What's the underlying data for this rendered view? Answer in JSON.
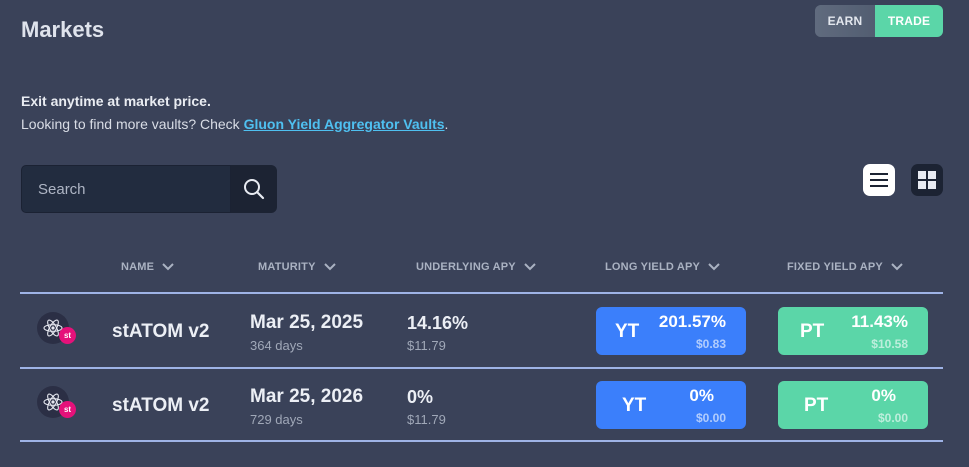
{
  "page": {
    "title": "Markets"
  },
  "mode_toggle": {
    "earn": "EARN",
    "trade": "TRADE",
    "active": "TRADE"
  },
  "intro": {
    "headline": "Exit anytime at market price.",
    "prefix": "Looking to find more vaults? Check ",
    "link": "Gluon Yield Aggregator Vaults",
    "suffix": "."
  },
  "search": {
    "placeholder": "Search",
    "value": ""
  },
  "view": {
    "active": "list"
  },
  "columns": {
    "name": "NAME",
    "maturity": "MATURITY",
    "underlying_apy": "UNDERLYING APY",
    "long_yield_apy": "LONG YIELD APY",
    "fixed_yield_apy": "FIXED YIELD APY"
  },
  "rows": [
    {
      "name": "stATOM v2",
      "badge": "st",
      "maturity_date": "Mar 25, 2025",
      "maturity_days": "364 days",
      "underlying_apy": "14.16%",
      "underlying_usd": "$11.79",
      "yt": {
        "label": "YT",
        "apy": "201.57%",
        "price": "$0.83"
      },
      "pt": {
        "label": "PT",
        "apy": "11.43%",
        "price": "$10.58"
      }
    },
    {
      "name": "stATOM v2",
      "badge": "st",
      "maturity_date": "Mar 25, 2026",
      "maturity_days": "729 days",
      "underlying_apy": "0%",
      "underlying_usd": "$11.79",
      "yt": {
        "label": "YT",
        "apy": "0%",
        "price": "$0.00"
      },
      "pt": {
        "label": "PT",
        "apy": "0%",
        "price": "$0.00"
      }
    }
  ],
  "colors": {
    "background": "#3a4259",
    "yt_button": "#3b7ffb",
    "pt_button": "#5bd6a8",
    "link": "#4fc0f0",
    "row_divider": "#9eb3e6",
    "st_badge": "#e5117a"
  }
}
